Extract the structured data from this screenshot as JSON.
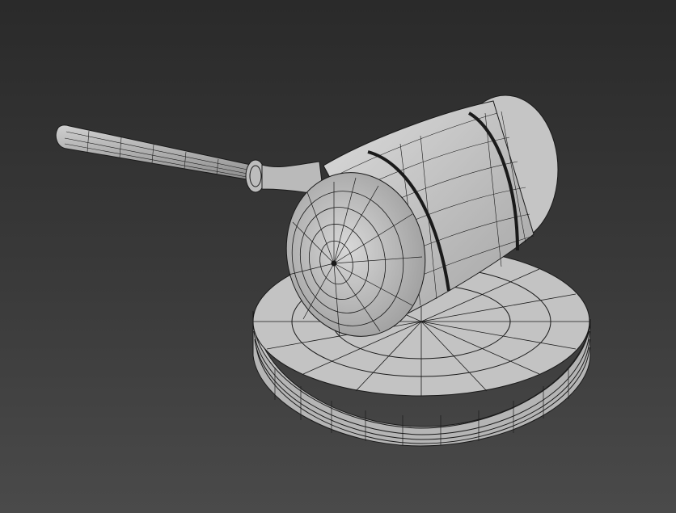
{
  "viewport": {
    "shading": "wireframe-over-gray",
    "background_top": "#2a2a2a",
    "background_bottom": "#4a4a4a",
    "mesh_fill": "#c9c9c9",
    "mesh_line": "#1a1a1a"
  },
  "scene": {
    "objects": [
      "gavel-handle",
      "gavel-head",
      "sound-block"
    ]
  }
}
